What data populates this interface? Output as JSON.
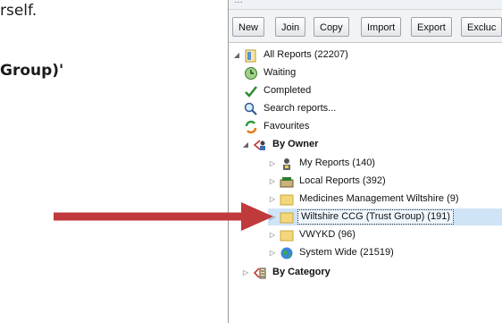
{
  "document": {
    "line1": "rself.",
    "line2": "Group)'"
  },
  "toolbar": {
    "buttons": [
      {
        "label": "New"
      },
      {
        "label": "Join"
      },
      {
        "label": "Copy"
      },
      {
        "label": "Import"
      },
      {
        "label": "Export"
      },
      {
        "label": "Excluc"
      }
    ]
  },
  "tree": {
    "items": [
      {
        "label": "All Reports (22207)",
        "icon": "reports-folder-icon"
      },
      {
        "label": "Waiting",
        "icon": "clock-icon"
      },
      {
        "label": "Completed",
        "icon": "check-icon"
      },
      {
        "label": "Search reports...",
        "icon": "search-icon"
      },
      {
        "label": "Favourites",
        "icon": "favourites-icon"
      },
      {
        "label": "By Owner",
        "icon": "owner-icon"
      },
      {
        "label": "My Reports (140)",
        "icon": "user-icon"
      },
      {
        "label": "Local Reports (392)",
        "icon": "local-folder-icon"
      },
      {
        "label": "Medicines Management Wiltshire (9)",
        "icon": "folder-icon"
      },
      {
        "label": "Wiltshire CCG (Trust Group) (191)",
        "icon": "folder-icon"
      },
      {
        "label": "VWYKD (96)",
        "icon": "folder-icon"
      },
      {
        "label": "System Wide (21519)",
        "icon": "globe-icon"
      },
      {
        "label": "By Category",
        "icon": "category-icon"
      }
    ]
  },
  "colors": {
    "arrow": "#c0393b",
    "folder": "#f3d77a",
    "selection": "#cfe4f7"
  }
}
